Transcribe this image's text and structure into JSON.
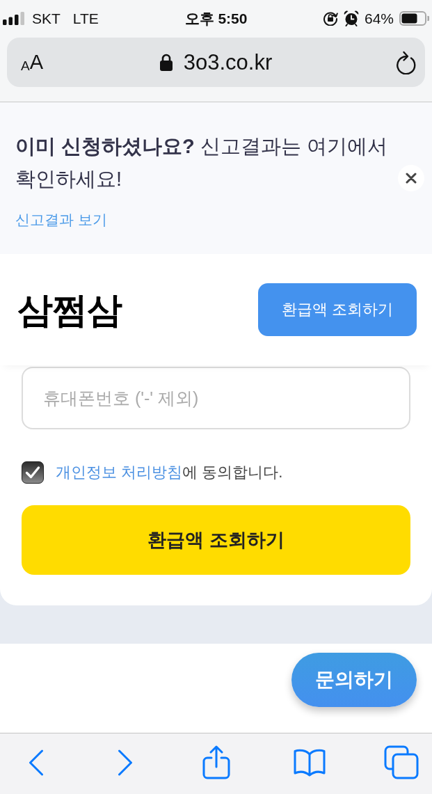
{
  "status_bar": {
    "carrier": "SKT",
    "network": "LTE",
    "time": "오후 5:50",
    "battery": "64%"
  },
  "address_bar": {
    "reader_button": {
      "small_letter": "A",
      "large_letter": "A"
    },
    "url": "3o3.co.kr"
  },
  "banner": {
    "title": "**이미 신청하셨나요?** 신고결과는 여기에서 확인하세요!",
    "link": "신고결과 보기"
  },
  "header": {
    "logo": "삼쩜삼",
    "button": "환급액 조회하기"
  },
  "form": {
    "phone_field": {
      "placeholder": "휴대폰번호 ('-' 제외)"
    },
    "consent": {
      "checked": true,
      "link": "개인정보 처리방침",
      "text": "에 동의합니다."
    },
    "submit_button": "환급액 조회하기"
  },
  "floating_button": "문의하기"
}
